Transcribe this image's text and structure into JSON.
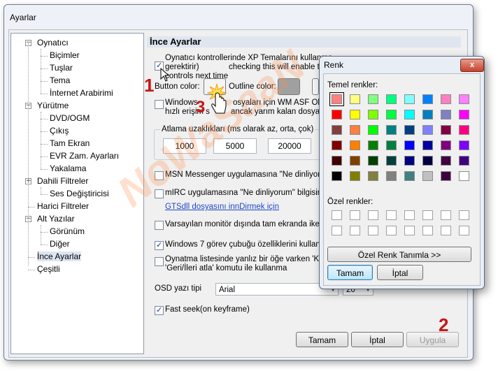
{
  "window": {
    "title": "Ayarlar"
  },
  "tree": {
    "items": [
      {
        "label": "Oynatıcı",
        "toggle": "−"
      },
      {
        "label": "Biçimler"
      },
      {
        "label": "Tuşlar"
      },
      {
        "label": "Tema"
      },
      {
        "label": "İnternet Arabirimi"
      },
      {
        "label": "Yürütme",
        "toggle": "−"
      },
      {
        "label": "DVD/OGM"
      },
      {
        "label": "Çıkış"
      },
      {
        "label": "Tam Ekran"
      },
      {
        "label": "EVR Zam. Ayarları"
      },
      {
        "label": "Yakalama"
      },
      {
        "label": "Dahili Filtreler",
        "toggle": "+"
      },
      {
        "label": "Ses Değiştiricisi"
      },
      {
        "label": "Harici Filtreler"
      },
      {
        "label": "Alt Yazılar",
        "toggle": "−"
      },
      {
        "label": "Görünüm"
      },
      {
        "label": "Diğer"
      },
      {
        "label": "İnce Ayarlar"
      },
      {
        "label": "Çeşitli"
      }
    ]
  },
  "pane": {
    "header": "İnce Ayarlar",
    "xp_theme_line1": "Oynatıcı kontrollerinde XP Temalarını kullanma",
    "xp_theme_line2": "gerektirir)",
    "xp_theme_line2b": "checking this will enable the ne",
    "xp_theme_line3": "controls next time",
    "button_color_label": "Button color:",
    "outline_color_label": "Outline color:",
    "wm_line1a": "Windows",
    "wm_line1b": "osyaları için WM ASF Okuyu",
    "wm_line2a": "hızlı erişim s",
    "wm_line2b": "ancak yarım kalan dosyala",
    "jump_label": "Atlama uzaklıkları (ms olarak az, orta, çok)",
    "jump_values": [
      "1000",
      "5000",
      "20000"
    ],
    "msn_label": "MSN Messenger uygulamasına \"Ne dinliyorum\" bil",
    "mirc_label": "mIRC uygulamasına \"Ne dinliyorum\" bilgisini G",
    "gts_link": "GTSdll dosyasını innDirmek için",
    "monitor_label": "Varsayılan monitör dışında tam ekranda iken k",
    "win7_label": "Windows 7 görev çubuğu özelliklerini kullan",
    "playlist_line1": "Oynatma listesinde yanlız bir öğe varken 'Klas",
    "playlist_line2": "'Geri/İleri atla' komutu ile kullanma",
    "osd_label": "OSD yazı tipi",
    "osd_font": "Arial",
    "osd_size": "20",
    "fastseek_label": "Fast seek(on keyframe)"
  },
  "buttons": {
    "ok": "Tamam",
    "cancel": "İptal",
    "apply": "Uygula"
  },
  "color_dialog": {
    "title": "Renk",
    "close": "x",
    "basic_label": "Temel renkler:",
    "custom_label": "Özel renkler:",
    "define_custom": "Özel Renk Tanımla >>",
    "ok": "Tamam",
    "cancel": "İptal",
    "basic_colors": [
      [
        "#ff8080",
        "#ffff80",
        "#80ff80",
        "#00ff80",
        "#80ffff",
        "#0080ff",
        "#ff80c0",
        "#ff80ff"
      ],
      [
        "#ff0000",
        "#ffff00",
        "#80ff00",
        "#00ff40",
        "#00ffff",
        "#0080c0",
        "#8080c0",
        "#ff00ff"
      ],
      [
        "#804040",
        "#ff8040",
        "#00ff00",
        "#008080",
        "#004080",
        "#8080ff",
        "#800040",
        "#ff0080"
      ],
      [
        "#800000",
        "#ff8000",
        "#008000",
        "#008040",
        "#0000ff",
        "#0000a0",
        "#800080",
        "#8000ff"
      ],
      [
        "#400000",
        "#804000",
        "#004000",
        "#004040",
        "#000080",
        "#000040",
        "#400040",
        "#400080"
      ],
      [
        "#000000",
        "#808000",
        "#808040",
        "#808080",
        "#408080",
        "#c0c0c0",
        "#400040",
        "#ffffff"
      ]
    ]
  },
  "annotations": {
    "step1": "1",
    "step2": "2",
    "step3": "3",
    "watermark": "NoWaSaaN"
  },
  "colors": {
    "selected_swatch": "#ff8080",
    "outline_swatch": "#a0a0a0",
    "accent": "#c81414"
  }
}
